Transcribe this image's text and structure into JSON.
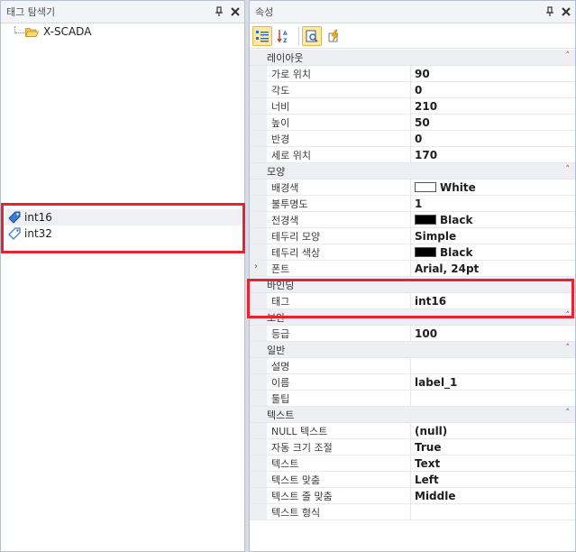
{
  "tag_panel": {
    "title": "태그 탐색기",
    "root_label": "X-SCADA",
    "tags": [
      "int16",
      "int32"
    ]
  },
  "prop_panel": {
    "title": "속성",
    "categories": [
      {
        "name": "레이아웃",
        "rows": [
          {
            "name": "가로 위치",
            "value": "90"
          },
          {
            "name": "각도",
            "value": "0"
          },
          {
            "name": "너비",
            "value": "210"
          },
          {
            "name": "높이",
            "value": "50"
          },
          {
            "name": "반경",
            "value": "0"
          },
          {
            "name": "세로 위치",
            "value": "170"
          }
        ]
      },
      {
        "name": "모양",
        "rows": [
          {
            "name": "배경색",
            "value": "White",
            "swatch": "#ffffff"
          },
          {
            "name": "불투명도",
            "value": "1"
          },
          {
            "name": "전경색",
            "value": "Black",
            "swatch": "#000000"
          },
          {
            "name": "테두리 모양",
            "value": "Simple"
          },
          {
            "name": "테두리 색상",
            "value": "Black",
            "swatch": "#000000"
          },
          {
            "name": "폰트",
            "value": "Arial, 24pt",
            "expandable": true
          }
        ]
      },
      {
        "name": "바인딩",
        "rows": [
          {
            "name": "태그",
            "value": "int16"
          }
        ]
      },
      {
        "name": "보안",
        "rows": [
          {
            "name": "등급",
            "value": "100"
          }
        ]
      },
      {
        "name": "일반",
        "rows": [
          {
            "name": "설명",
            "value": ""
          },
          {
            "name": "이름",
            "value": "label_1"
          },
          {
            "name": "툴팁",
            "value": ""
          }
        ]
      },
      {
        "name": "텍스트",
        "rows": [
          {
            "name": "NULL 텍스트",
            "value": "(null)"
          },
          {
            "name": "자동 크기 조절",
            "value": "True"
          },
          {
            "name": "텍스트",
            "value": "Text"
          },
          {
            "name": "텍스트 맞춤",
            "value": "Left"
          },
          {
            "name": "텍스트 줄 맞춤",
            "value": "Middle"
          },
          {
            "name": "텍스트 형식",
            "value": ""
          }
        ]
      }
    ]
  },
  "colors": {
    "highlight": "#e8232f",
    "accent": "#fbe9a8"
  }
}
